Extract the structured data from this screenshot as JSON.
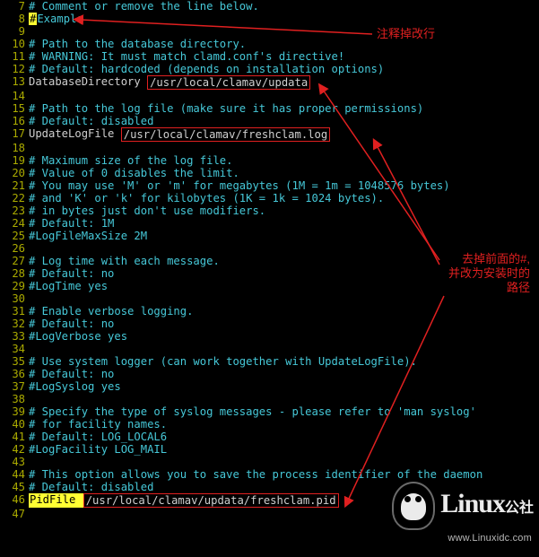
{
  "annotations": {
    "top_right": "注释掉改行",
    "right_block_line1": "去掉前面的#,",
    "right_block_line2": "并改为安装时的",
    "right_block_line3": "路径"
  },
  "watermark": {
    "brand_main": "Linux",
    "brand_suffix": "公社",
    "url": "www.Linuxidc.com"
  },
  "lines": [
    {
      "n": 7,
      "segs": [
        {
          "t": "# Comment or remove the line below.",
          "cls": "comment"
        }
      ]
    },
    {
      "n": 8,
      "segs": [
        {
          "t": "#",
          "cls": "hi"
        },
        {
          "t": "Example",
          "cls": "comment"
        }
      ]
    },
    {
      "n": 9,
      "segs": [
        {
          "t": "",
          "cls": "plain"
        }
      ]
    },
    {
      "n": 10,
      "segs": [
        {
          "t": "# Path to the database directory.",
          "cls": "comment"
        }
      ]
    },
    {
      "n": 11,
      "segs": [
        {
          "t": "# WARNING: It must match clamd.conf's directive!",
          "cls": "comment"
        }
      ]
    },
    {
      "n": 12,
      "segs": [
        {
          "t": "# Default: hardcoded (depends on installation options)",
          "cls": "comment"
        }
      ]
    },
    {
      "n": 13,
      "segs": [
        {
          "t": "DatabaseDirectory ",
          "cls": "plain"
        },
        {
          "t": "/usr/local/clamav/updata",
          "cls": "outline"
        }
      ]
    },
    {
      "n": 14,
      "segs": [
        {
          "t": "",
          "cls": "plain"
        }
      ]
    },
    {
      "n": 15,
      "segs": [
        {
          "t": "# Path to the log file (make sure it has proper permissions)",
          "cls": "comment"
        }
      ]
    },
    {
      "n": 16,
      "segs": [
        {
          "t": "# Default: disabled",
          "cls": "comment"
        }
      ]
    },
    {
      "n": 17,
      "segs": [
        {
          "t": "UpdateLogFile ",
          "cls": "plain"
        },
        {
          "t": "/usr/local/clamav/freshclam.log",
          "cls": "outline"
        }
      ]
    },
    {
      "n": 18,
      "segs": [
        {
          "t": "",
          "cls": "plain"
        }
      ]
    },
    {
      "n": 19,
      "segs": [
        {
          "t": "# Maximum size of the log file.",
          "cls": "comment"
        }
      ]
    },
    {
      "n": 20,
      "segs": [
        {
          "t": "# Value of 0 disables the limit.",
          "cls": "comment"
        }
      ]
    },
    {
      "n": 21,
      "segs": [
        {
          "t": "# You may use 'M' or 'm' for megabytes (1M = 1m = 1048576 bytes)",
          "cls": "comment"
        }
      ]
    },
    {
      "n": 22,
      "segs": [
        {
          "t": "# and 'K' or 'k' for kilobytes (1K = 1k = 1024 bytes).",
          "cls": "comment"
        }
      ]
    },
    {
      "n": 23,
      "segs": [
        {
          "t": "# in bytes just don't use modifiers.",
          "cls": "comment"
        }
      ]
    },
    {
      "n": 24,
      "segs": [
        {
          "t": "# Default: 1M",
          "cls": "comment"
        }
      ]
    },
    {
      "n": 25,
      "segs": [
        {
          "t": "#LogFileMaxSize 2M",
          "cls": "comment"
        }
      ]
    },
    {
      "n": 26,
      "segs": [
        {
          "t": "",
          "cls": "plain"
        }
      ]
    },
    {
      "n": 27,
      "segs": [
        {
          "t": "# Log time with each message.",
          "cls": "comment"
        }
      ]
    },
    {
      "n": 28,
      "segs": [
        {
          "t": "# Default: no",
          "cls": "comment"
        }
      ]
    },
    {
      "n": 29,
      "segs": [
        {
          "t": "#LogTime yes",
          "cls": "comment"
        }
      ]
    },
    {
      "n": 30,
      "segs": [
        {
          "t": "",
          "cls": "plain"
        }
      ]
    },
    {
      "n": 31,
      "segs": [
        {
          "t": "# Enable verbose logging.",
          "cls": "comment"
        }
      ]
    },
    {
      "n": 32,
      "segs": [
        {
          "t": "# Default: no",
          "cls": "comment"
        }
      ]
    },
    {
      "n": 33,
      "segs": [
        {
          "t": "#LogVerbose yes",
          "cls": "comment"
        }
      ]
    },
    {
      "n": 34,
      "segs": [
        {
          "t": "",
          "cls": "plain"
        }
      ]
    },
    {
      "n": 35,
      "segs": [
        {
          "t": "# Use system logger (can work together with UpdateLogFile).",
          "cls": "comment"
        }
      ]
    },
    {
      "n": 36,
      "segs": [
        {
          "t": "# Default: no",
          "cls": "comment"
        }
      ]
    },
    {
      "n": 37,
      "segs": [
        {
          "t": "#LogSyslog yes",
          "cls": "comment"
        }
      ]
    },
    {
      "n": 38,
      "segs": [
        {
          "t": "",
          "cls": "plain"
        }
      ]
    },
    {
      "n": 39,
      "segs": [
        {
          "t": "# Specify the type of syslog messages - please refer to 'man syslog'",
          "cls": "comment"
        }
      ]
    },
    {
      "n": 40,
      "segs": [
        {
          "t": "# for facility names.",
          "cls": "comment"
        }
      ]
    },
    {
      "n": 41,
      "segs": [
        {
          "t": "# Default: LOG_LOCAL6",
          "cls": "comment"
        }
      ]
    },
    {
      "n": 42,
      "segs": [
        {
          "t": "#LogFacility LOG_MAIL",
          "cls": "comment"
        }
      ]
    },
    {
      "n": 43,
      "segs": [
        {
          "t": "",
          "cls": "plain"
        }
      ]
    },
    {
      "n": 44,
      "segs": [
        {
          "t": "# This option allows you to save the process identifier of the daemon",
          "cls": "comment"
        }
      ]
    },
    {
      "n": 45,
      "segs": [
        {
          "t": "# Default: disabled",
          "cls": "comment"
        }
      ]
    },
    {
      "n": 46,
      "segs": [
        {
          "t": "PidFile ",
          "cls": "hi"
        },
        {
          "t": "/usr/local/clamav/updata/freshclam.pid",
          "cls": "outline"
        }
      ]
    },
    {
      "n": 47,
      "segs": [
        {
          "t": "",
          "cls": "plain"
        }
      ]
    }
  ]
}
